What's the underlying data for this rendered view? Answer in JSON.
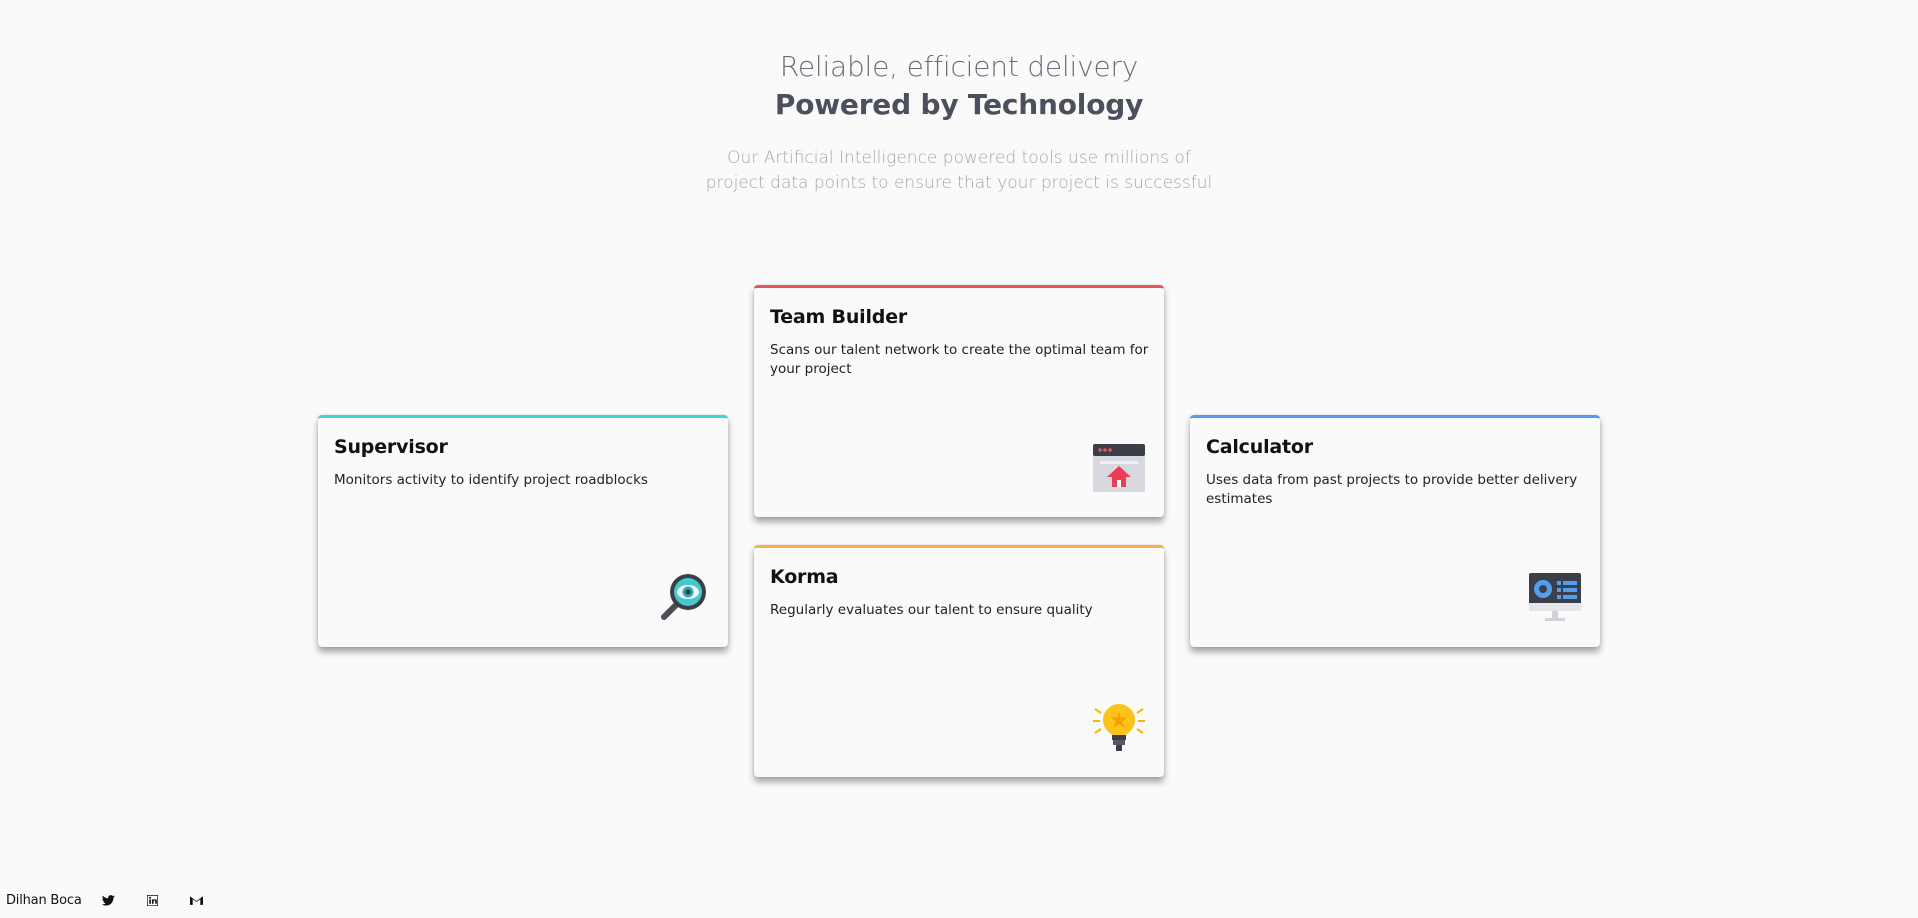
{
  "hero": {
    "subtitle": "Reliable, efficient delivery",
    "title": "Powered by Technology",
    "description": "Our Artificial Intelligence powered tools use millions of project data points to ensure that your project is successful"
  },
  "cards": {
    "supervisor": {
      "title": "Supervisor",
      "description": "Monitors activity to identify project roadblocks",
      "accent": "#44d3d2",
      "icon": "magnifier-eye-icon"
    },
    "team_builder": {
      "title": "Team Builder",
      "description": "Scans our talent network to create the optimal team for your project",
      "accent": "#ea5454",
      "icon": "browser-upload-icon"
    },
    "karma": {
      "title": "Korma",
      "description": "Regularly evaluates our talent to ensure quality",
      "accent": "#fcae4a",
      "icon": "lightbulb-icon"
    },
    "calculator": {
      "title": "Calculator",
      "description": "Uses data from past projects to provide better delivery estimates",
      "accent": "#549ef2",
      "icon": "monitor-chart-icon"
    }
  },
  "footer": {
    "author": "Dilhan Boca",
    "links": [
      "twitter-icon",
      "linkedin-icon",
      "gmail-icon"
    ]
  }
}
